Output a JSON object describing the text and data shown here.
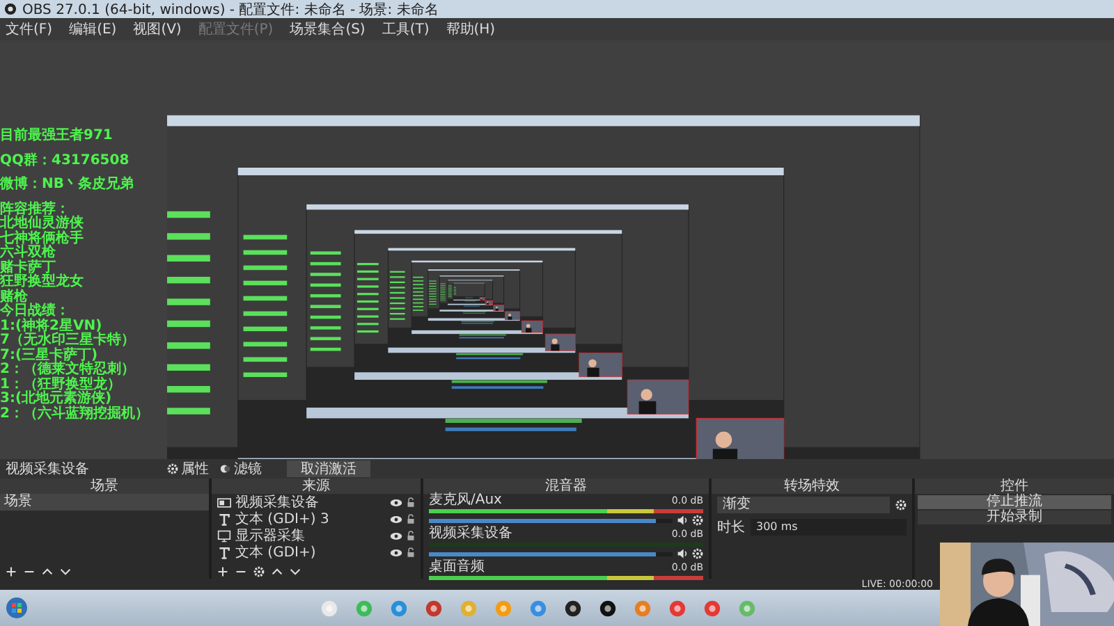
{
  "window": {
    "title": "OBS 27.0.1 (64-bit, windows) - 配置文件: 未命名 - 场景: 未命名"
  },
  "menu": [
    {
      "label": "文件(F)",
      "disabled": false
    },
    {
      "label": "编辑(E)",
      "disabled": false
    },
    {
      "label": "视图(V)",
      "disabled": false
    },
    {
      "label": "配置文件(P)",
      "disabled": true
    },
    {
      "label": "场景集合(S)",
      "disabled": false
    },
    {
      "label": "工具(T)",
      "disabled": false
    },
    {
      "label": "帮助(H)",
      "disabled": false
    }
  ],
  "preview": {
    "overlay_lines": [
      {
        "text": "目前最强王者971",
        "gap_before": false
      },
      {
        "text": "QQ群：43176508",
        "gap_before": true
      },
      {
        "text": "微博：NB丶条皮兄弟",
        "gap_before": true
      },
      {
        "text": "阵容推荐：",
        "gap_before": true
      },
      {
        "text": "北地仙灵游侠",
        "gap_before": false
      },
      {
        "text": "七神将俩枪手",
        "gap_before": false
      },
      {
        "text": "六斗双枪",
        "gap_before": false
      },
      {
        "text": "赌卡萨丁",
        "gap_before": false
      },
      {
        "text": "狂野换型龙女",
        "gap_before": false
      },
      {
        "text": "赌枪",
        "gap_before": false
      },
      {
        "text": "今日战绩：",
        "gap_before": false
      },
      {
        "text": "1:(神将2星VN)",
        "gap_before": false
      },
      {
        "text": "7（无水印三星卡特）",
        "gap_before": false
      },
      {
        "text": "7:(三星卡萨丁)",
        "gap_before": false
      },
      {
        "text": "2：（德莱文特忍刺）",
        "gap_before": false
      },
      {
        "text": "1：（狂野换型龙）",
        "gap_before": false
      },
      {
        "text": "3:(北地元素游侠)",
        "gap_before": false
      },
      {
        "text": "2：（六斗蓝翔挖掘机）",
        "gap_before": false
      }
    ]
  },
  "toolbar": {
    "source_name": "视频采集设备",
    "buttons": [
      {
        "label": "属性",
        "kind": "gear"
      },
      {
        "label": "滤镜",
        "kind": "filter"
      },
      {
        "label": "取消激活",
        "kind": "plain"
      }
    ]
  },
  "scenes": {
    "title": "场景",
    "items": [
      {
        "label": "场景",
        "selected": true
      }
    ]
  },
  "sources": {
    "title": "来源",
    "items": [
      {
        "label": "视频采集设备",
        "kind": "camera"
      },
      {
        "label": "文本 (GDI+) 3",
        "kind": "text"
      },
      {
        "label": "显示器采集",
        "kind": "monitor"
      },
      {
        "label": "文本 (GDI+)",
        "kind": "text"
      }
    ]
  },
  "mixer": {
    "title": "混音器",
    "channels": [
      {
        "name": "麦克风/Aux",
        "reading": "0.0 dB",
        "meter": true,
        "level": 0.93
      },
      {
        "name": "视频采集设备",
        "reading": "0.0 dB",
        "meter": false,
        "level": 0.93
      },
      {
        "name": "桌面音频",
        "reading": "0.0 dB",
        "meter": true
      }
    ]
  },
  "transitions": {
    "title": "转场特效",
    "type": "渐变",
    "duration_label": "时长",
    "duration": "300 ms"
  },
  "controls": {
    "title": "控件",
    "buttons": [
      {
        "label": "停止推流",
        "selected": true
      },
      {
        "label": "开始录制",
        "selected": false
      }
    ]
  },
  "status": {
    "live": "LIVE: 00:00:00"
  }
}
